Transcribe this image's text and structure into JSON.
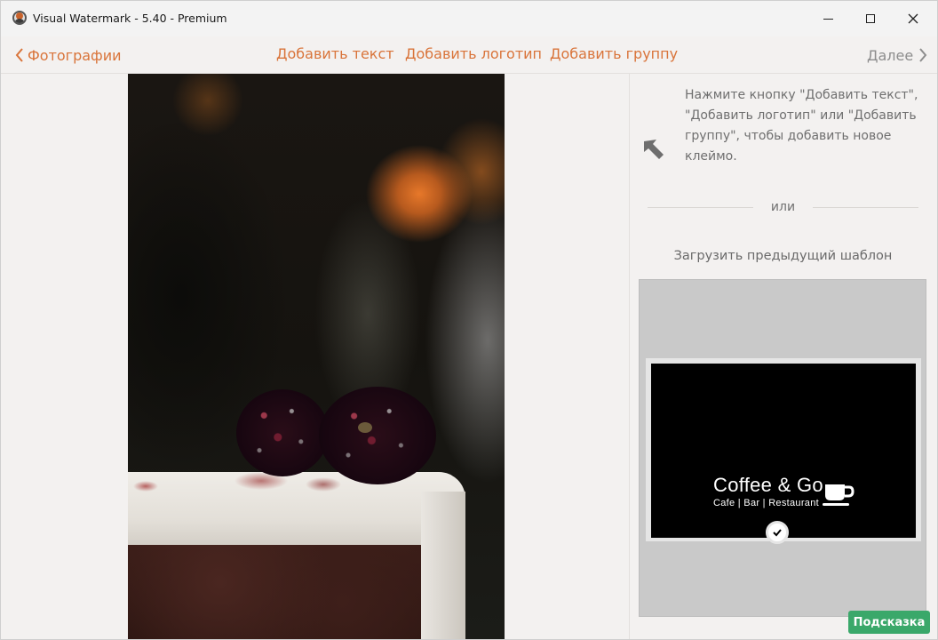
{
  "window": {
    "title": "Visual Watermark - 5.40 - Premium"
  },
  "toolbar": {
    "back_label": "Фотографии",
    "add_text": "Добавить текст",
    "add_logo": "Добавить логотип",
    "add_group": "Добавить группу",
    "next_label": "Далее"
  },
  "side_panel": {
    "hint": "Нажмите кнопку \"Добавить текст\", \"Добавить логотип\" или \"Добавить группу\", чтобы добавить новое клеймо.",
    "or_text": "или",
    "template_label": "Загрузить предыдущий шаблон",
    "template": {
      "logo_title": "Coffee & Go",
      "logo_subtitle": "Cafe | Bar | Restaurant"
    }
  },
  "help_button": "Подсказка",
  "colors": {
    "accent": "#d9743a",
    "help_green": "#3aa86a"
  },
  "icons": {
    "back": "chevron-left-icon",
    "next": "chevron-right-icon",
    "hint": "arrow-up-left-icon",
    "template_cup": "coffee-cup-icon",
    "template_badge": "checkmark-icon"
  }
}
